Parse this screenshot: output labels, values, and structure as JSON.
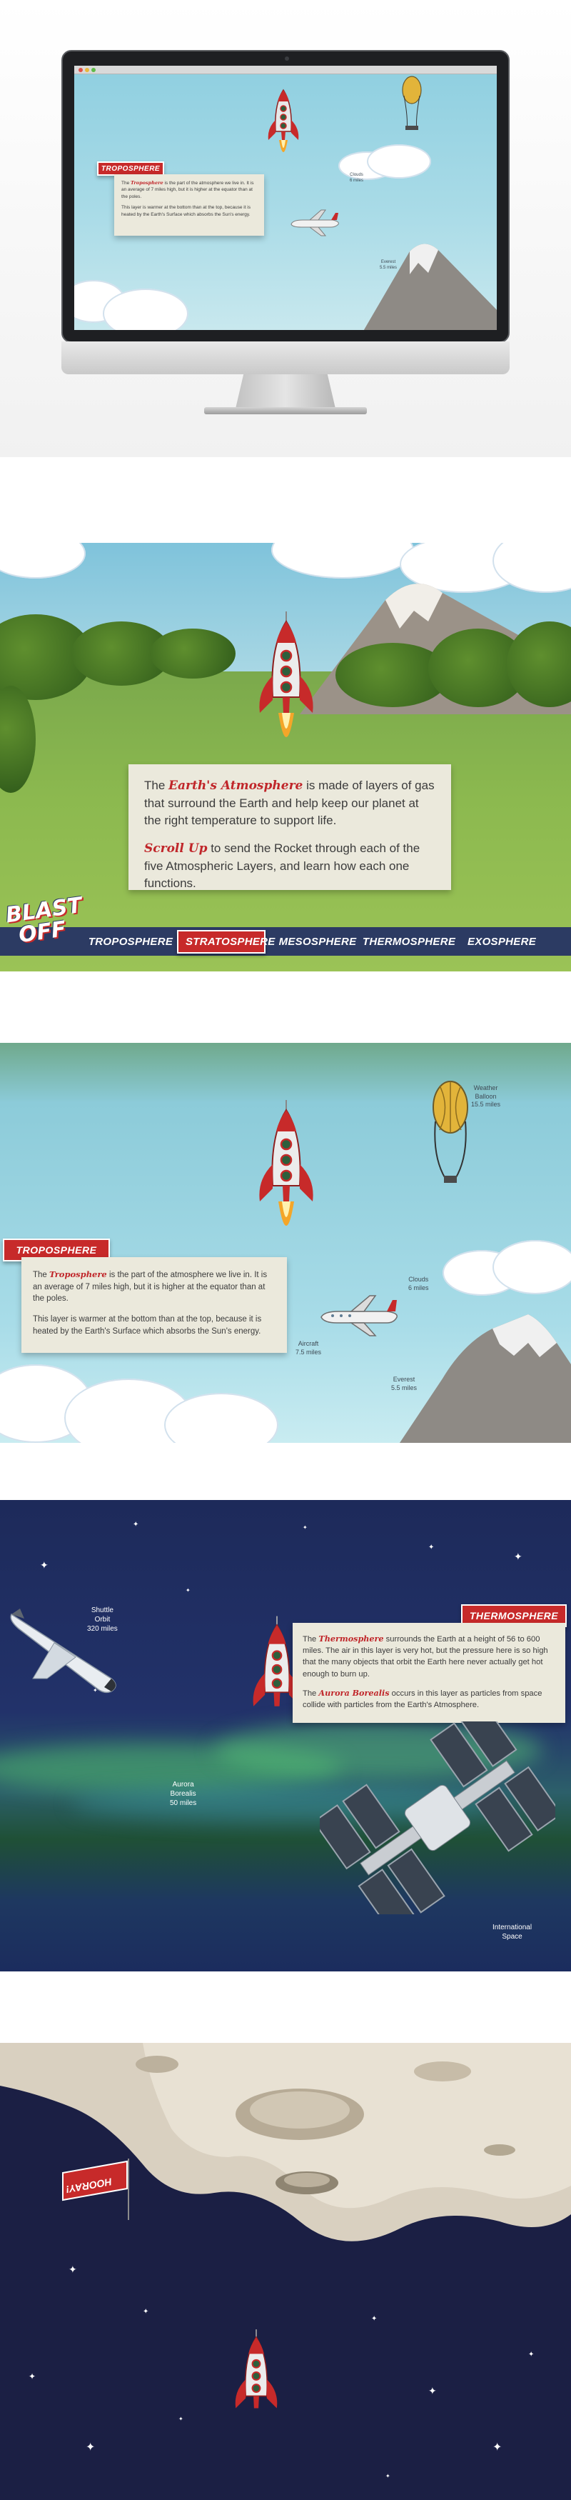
{
  "monitor": {
    "screen": {
      "ribbon_label": "TROPOSPHERE",
      "info_line1_pre": "The ",
      "info_line1_accent": "Troposphere",
      "info_line1_post": " is the part of the atmosphere we live in. It is an average of 7 miles high, but it is higher at the equator than at the poles.",
      "info_line2": "This layer is warmer at the bottom than at the top, because it is heated by the Earth's Surface which absorbs the Sun's energy.",
      "label_clouds": "Clouds\n6 miles",
      "label_everest": "Everest\n5.5 miles"
    }
  },
  "intro": {
    "logo_line1": "BLAST",
    "logo_line2": "OFF",
    "paragraph1_pre": "The ",
    "paragraph1_accent": "Earth's Atmosphere",
    "paragraph1_post": " is made of layers of gas that surround the Earth and help keep our planet at the right temperature to support life.",
    "paragraph2_accent": "Scroll Up",
    "paragraph2_post": " to send the Rocket through each of the five Atmospheric Layers, and learn how each one functions.",
    "nav": [
      {
        "label": "TROPOSPHERE",
        "active": false
      },
      {
        "label": "STRATOSPHERE",
        "active": true
      },
      {
        "label": "MESOSPHERE",
        "active": false
      },
      {
        "label": "THERMOSPHERE",
        "active": false
      },
      {
        "label": "EXOSPHERE",
        "active": false
      }
    ]
  },
  "troposphere": {
    "ribbon_label": "TROPOSPHERE",
    "para1_pre": "The ",
    "para1_accent": "Troposphere",
    "para1_post": " is the part of the atmosphere we live in. It is an average of 7 miles high, but it is higher at the equator than at the poles.",
    "para2": "This layer is warmer at the bottom than at the top, because it is heated by the Earth's Surface which absorbs the Sun's energy.",
    "label_balloon": "Weather\nBalloon\n15.5 miles",
    "label_clouds": "Clouds\n6 miles",
    "label_aircraft": "Aircraft\n7.5 miles",
    "label_everest": "Everest\n5.5 miles"
  },
  "thermosphere": {
    "ribbon_label": "THERMOSPHERE",
    "para1_pre": "The ",
    "para1_accent": "Thermosphere",
    "para1_post": " surrounds the Earth at a height of 56 to 600 miles. The air in this layer is very hot, but the pressure here is so high that the many objects that orbit the Earth here never actually get hot enough to burn up.",
    "para2_pre": "The ",
    "para2_accent": "Aurora Borealis",
    "para2_post": " occurs in this layer as particles from space collide with particles from the Earth's Atmosphere.",
    "label_shuttle": "Shuttle\nOrbit\n320 miles",
    "label_aurora": "Aurora\nBorealis\n50 miles",
    "label_iss": "International\nSpace"
  },
  "exosphere": {
    "flag_label": "HOORAY!"
  },
  "colors": {
    "accent_red": "#c72a2a",
    "nav_navy": "#2c3b63",
    "info_bg": "#ebe9dc",
    "night_sky": "#1b1f44"
  }
}
